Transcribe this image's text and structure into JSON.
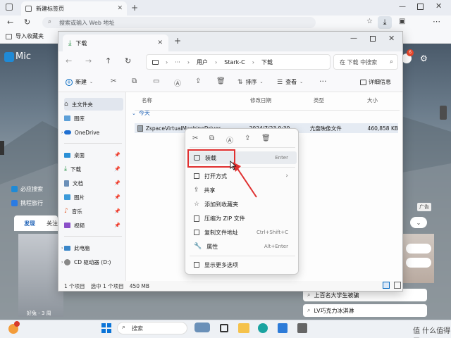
{
  "browser": {
    "tab_title": "新建标签页",
    "address_placeholder": "搜索或输入 Web 地址",
    "import_favorites": "导入收藏夹",
    "notification_count": "6"
  },
  "newtab": {
    "logo_text": "Mic",
    "news_item_1": "必应搜索",
    "news_item_2": "携程旅行",
    "tab_discover": "发现",
    "tab_follow": "关注",
    "ad_label": "广告",
    "right_list_1": "上百名大学生被骗",
    "right_list_2": "LV巧克力冰淇淋",
    "weather": "好兔 - 3 周"
  },
  "explorer": {
    "tab_title": "下载",
    "path": [
      "用户",
      "Stark-C",
      "下载"
    ],
    "search_placeholder": "在 下载 中搜索",
    "toolbar": {
      "new_label": "新建",
      "sort_label": "排序",
      "view_label": "查看",
      "details_label": "详细信息"
    },
    "sidebar": [
      {
        "label": "主文件夹"
      },
      {
        "label": "图库"
      },
      {
        "label": "OneDrive"
      },
      {
        "label": "桌面"
      },
      {
        "label": "下载"
      },
      {
        "label": "文档"
      },
      {
        "label": "图片"
      },
      {
        "label": "音乐"
      },
      {
        "label": "视频"
      },
      {
        "label": "此电脑"
      },
      {
        "label": "CD 驱动器 (D:)"
      }
    ],
    "columns": {
      "name": "名称",
      "date": "修改日期",
      "type": "类型",
      "size": "大小"
    },
    "group_label": "今天",
    "file": {
      "name": "ZspaceVirtualMachineDriver",
      "date": "2024/7/23 9:39",
      "type": "光盘映像文件",
      "size": "460,858 KB"
    },
    "status": {
      "count": "1 个项目",
      "selected": "选中 1 个项目",
      "size": "450 MB"
    }
  },
  "context_menu": {
    "items": [
      {
        "label": "装载",
        "shortcut": "Enter"
      },
      {
        "label": "打开方式",
        "shortcut": ""
      },
      {
        "label": "共享",
        "shortcut": ""
      },
      {
        "label": "添加到收藏夹",
        "shortcut": ""
      },
      {
        "label": "压缩为 ZIP 文件",
        "shortcut": ""
      },
      {
        "label": "复制文件地址",
        "shortcut": "Ctrl+Shift+C"
      },
      {
        "label": "属性",
        "shortcut": "Alt+Enter"
      },
      {
        "label": "显示更多选项",
        "shortcut": ""
      }
    ]
  },
  "taskbar": {
    "search_label": "搜索",
    "watermark": "值 什么值得买"
  },
  "colors": {
    "accent": "#0067c0",
    "highlight_red": "#e03030",
    "selection": "#e5ebf3"
  }
}
